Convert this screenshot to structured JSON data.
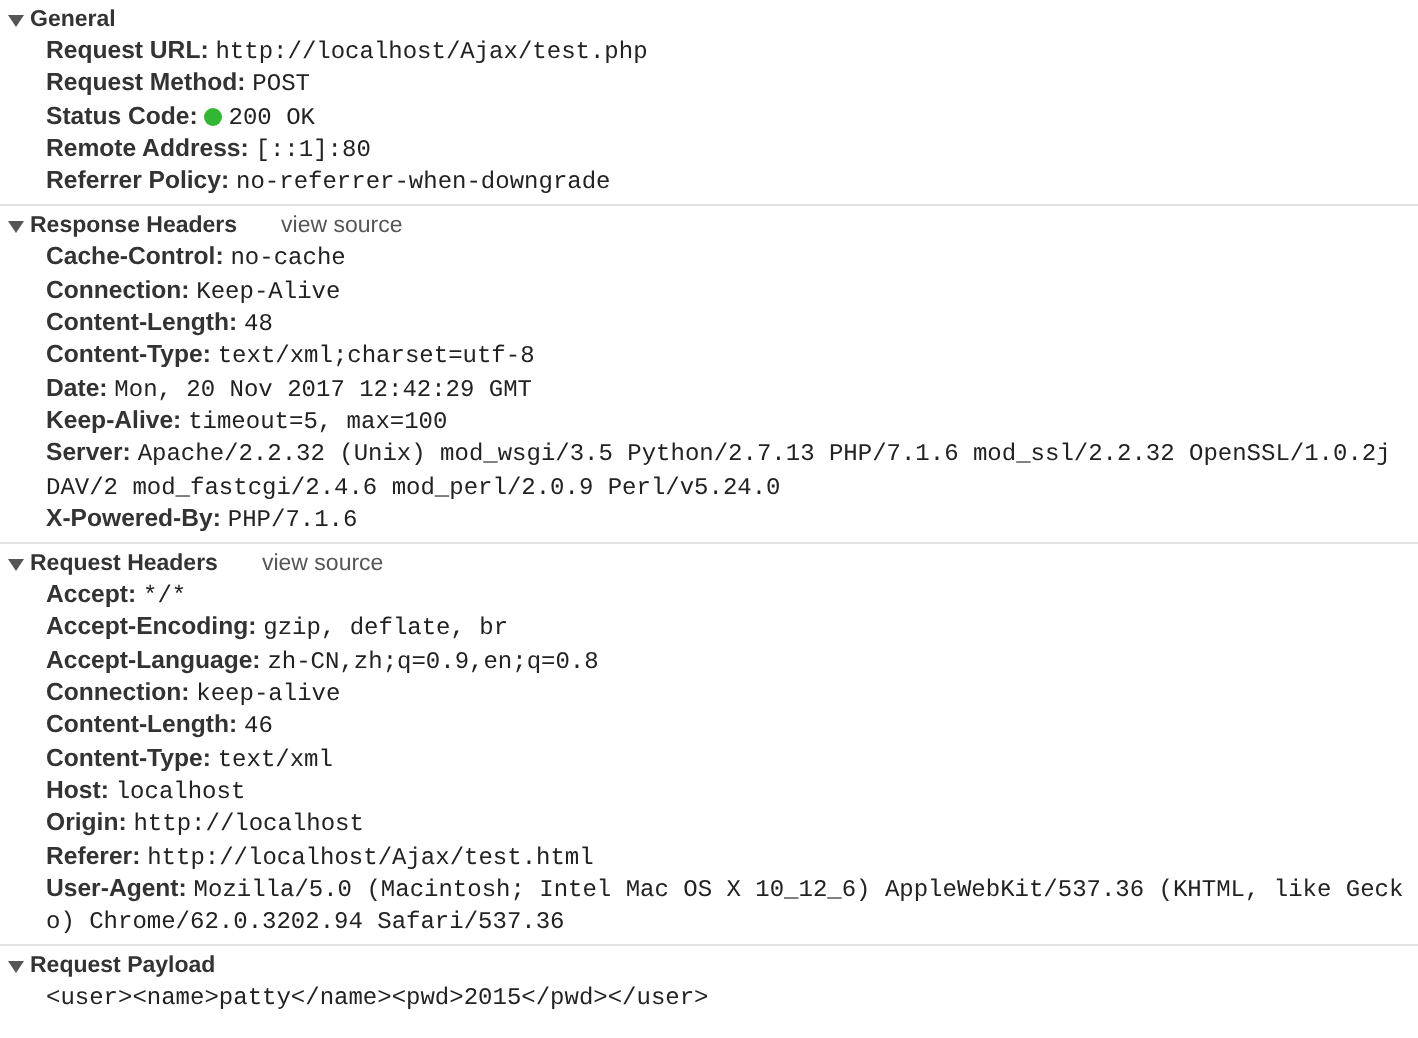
{
  "sections": [
    {
      "title": "General",
      "expanded": true,
      "rows": [
        {
          "key": "Request URL:",
          "value": "http://localhost/Ajax/test.php"
        },
        {
          "key": "Request Method:",
          "value": "POST"
        },
        {
          "key": "Status Code:",
          "value": "200 OK",
          "color": "#33b633"
        },
        {
          "key": "Remote Address:",
          "value": "[::1]:80"
        },
        {
          "key": "Referrer Policy:",
          "value": "no-referrer-when-downgrade"
        }
      ]
    },
    {
      "title": "Response Headers",
      "expanded": true,
      "link": "view source",
      "rows": [
        {
          "key": "Cache-Control:",
          "value": "no-cache"
        },
        {
          "key": "Connection:",
          "value": "Keep-Alive"
        },
        {
          "key": "Content-Length:",
          "value": "48"
        },
        {
          "key": "Content-Type:",
          "value": "text/xml;charset=utf-8"
        },
        {
          "key": "Date:",
          "value": "Mon, 20 Nov 2017 12:42:29 GMT"
        },
        {
          "key": "Keep-Alive:",
          "value": "timeout=5, max=100"
        },
        {
          "key": "Server:",
          "value": "Apache/2.2.32 (Unix) mod_wsgi/3.5 Python/2.7.13 PHP/7.1.6 mod_ssl/2.2.32 OpenSSL/1.0.2j DAV/2 mod_fastcgi/2.4.6 mod_perl/2.0.9 Perl/v5.24.0"
        },
        {
          "key": "X-Powered-By:",
          "value": "PHP/7.1.6"
        }
      ]
    },
    {
      "title": "Request Headers",
      "expanded": true,
      "link": "view source",
      "rows": [
        {
          "key": "Accept:",
          "value": "*/*"
        },
        {
          "key": "Accept-Encoding:",
          "value": "gzip, deflate, br"
        },
        {
          "key": "Accept-Language:",
          "value": "zh-CN,zh;q=0.9,en;q=0.8"
        },
        {
          "key": "Connection:",
          "value": "keep-alive"
        },
        {
          "key": "Content-Length:",
          "value": "46"
        },
        {
          "key": "Content-Type:",
          "value": "text/xml"
        },
        {
          "key": "Host:",
          "value": "localhost"
        },
        {
          "key": "Origin:",
          "value": "http://localhost"
        },
        {
          "key": "Referer:",
          "value": "http://localhost/Ajax/test.html"
        },
        {
          "key": "User-Agent:",
          "value": "Mozilla/5.0 (Macintosh; Intel Mac OS X 10_12_6) AppleWebKit/537.36 (KHTML, like Gecko) Chrome/62.0.3202.94 Safari/537.36"
        }
      ]
    },
    {
      "title": "Request Payload",
      "expanded": true,
      "rows": [
        {
          "value": "<user><name>patty</name><pwd>2015</pwd></user>"
        }
      ]
    }
  ]
}
